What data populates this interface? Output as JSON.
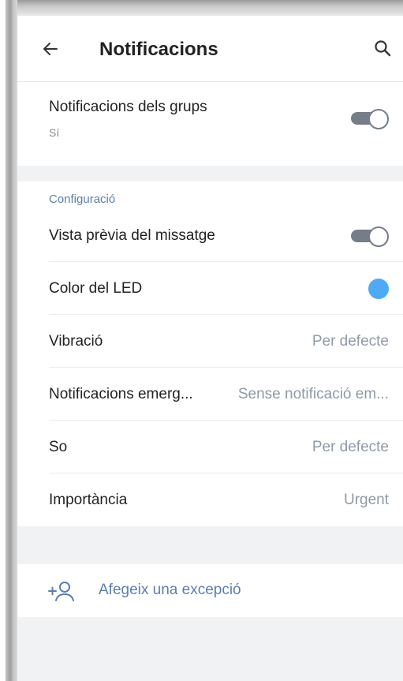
{
  "header": {
    "back_icon": "arrow-left-icon",
    "title": "Notificacions",
    "search_icon": "search-icon"
  },
  "group_notifications": {
    "label": "Notificacions dels grups",
    "value": "Sí",
    "enabled": true
  },
  "settings": {
    "section_title": "Configuració",
    "preview": {
      "label": "Vista prèvia del missatge",
      "enabled": true
    },
    "led_color": {
      "label": "Color del LED",
      "color": "#4eaaf5"
    },
    "vibration": {
      "label": "Vibració",
      "value": "Per defecte"
    },
    "popup": {
      "label": "Notificacions emerg...",
      "value": "Sense notificació em..."
    },
    "sound": {
      "label": "So",
      "value": "Per defecte"
    },
    "importance": {
      "label": "Importància",
      "value": "Urgent"
    }
  },
  "exceptions": {
    "add_label": "Afegeix una excepció",
    "add_icon": "add-user-icon"
  },
  "colors": {
    "accent": "#5b7fad",
    "toggle": "#757d89",
    "secondary_text": "#8f9aa6",
    "section_background": "#f1f2f4"
  }
}
